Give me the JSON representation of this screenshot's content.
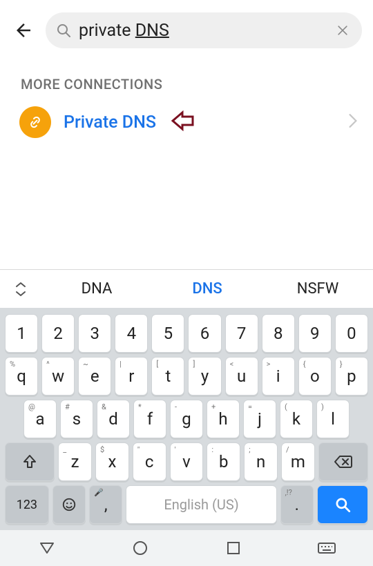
{
  "search": {
    "text_prefix": "private ",
    "text_highlight": "DNS"
  },
  "section_header": "MORE CONNECTIONS",
  "result": {
    "label": "Private DNS"
  },
  "suggestions": [
    "DNA",
    "DNS",
    "NSFW"
  ],
  "keyboard": {
    "row_num": [
      "1",
      "2",
      "3",
      "4",
      "5",
      "6",
      "7",
      "8",
      "9",
      "0"
    ],
    "row_q": [
      {
        "main": "q",
        "hint": "%"
      },
      {
        "main": "w",
        "hint": "^"
      },
      {
        "main": "e",
        "hint": "~"
      },
      {
        "main": "r",
        "hint": "|"
      },
      {
        "main": "t",
        "hint": "["
      },
      {
        "main": "y",
        "hint": "]"
      },
      {
        "main": "u",
        "hint": "<"
      },
      {
        "main": "i",
        "hint": ">"
      },
      {
        "main": "o",
        "hint": "{"
      },
      {
        "main": "p",
        "hint": "}"
      }
    ],
    "row_a": [
      {
        "main": "a",
        "hint": "@"
      },
      {
        "main": "s",
        "hint": "#"
      },
      {
        "main": "d",
        "hint": "&"
      },
      {
        "main": "f",
        "hint": "*"
      },
      {
        "main": "g",
        "hint": "-"
      },
      {
        "main": "h",
        "hint": "+"
      },
      {
        "main": "j",
        "hint": "="
      },
      {
        "main": "k",
        "hint": "("
      },
      {
        "main": "l",
        "hint": ")"
      }
    ],
    "row_z": [
      {
        "main": "z",
        "hint": "_"
      },
      {
        "main": "x",
        "hint": "$"
      },
      {
        "main": "c",
        "hint": "\""
      },
      {
        "main": "v",
        "hint": "'"
      },
      {
        "main": "b",
        "hint": ":"
      },
      {
        "main": "n",
        "hint": ";"
      },
      {
        "main": "m",
        "hint": "/"
      }
    ],
    "sym_key": "123",
    "space_label": "English (US)",
    "period_key": ".",
    "period_hint": ",!?",
    "comma_key": ",",
    "comma_hint": "🎤"
  }
}
